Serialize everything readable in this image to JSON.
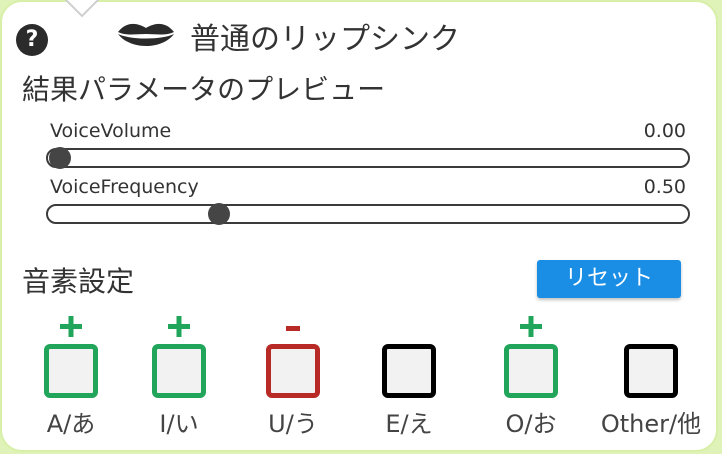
{
  "header": {
    "title": "普通のリップシンク",
    "help_icon_text": "?"
  },
  "preview": {
    "heading": "結果パラメータのプレビュー",
    "sliders": [
      {
        "label": "VoiceVolume",
        "value_text": "0.00",
        "value": 0.0
      },
      {
        "label": "VoiceFrequency",
        "value_text": "0.50",
        "value": 0.5
      }
    ]
  },
  "phonemes": {
    "heading": "音素設定",
    "reset_label": "リセット",
    "items": [
      {
        "label": "A/あ",
        "sign": "+",
        "state": "plus",
        "color": "#21a55a"
      },
      {
        "label": "I/い",
        "sign": "+",
        "state": "plus",
        "color": "#21a55a"
      },
      {
        "label": "U/う",
        "sign": "-",
        "state": "minus",
        "color": "#b82a26"
      },
      {
        "label": "E/え",
        "sign": "",
        "state": "none",
        "color": "#000000"
      },
      {
        "label": "O/お",
        "sign": "+",
        "state": "plus",
        "color": "#21a55a"
      },
      {
        "label": "Other/他",
        "sign": "",
        "state": "none",
        "color": "#000000"
      }
    ]
  },
  "colors": {
    "reset_button": "#1a8de5",
    "panel_border": "#d7efa7"
  }
}
